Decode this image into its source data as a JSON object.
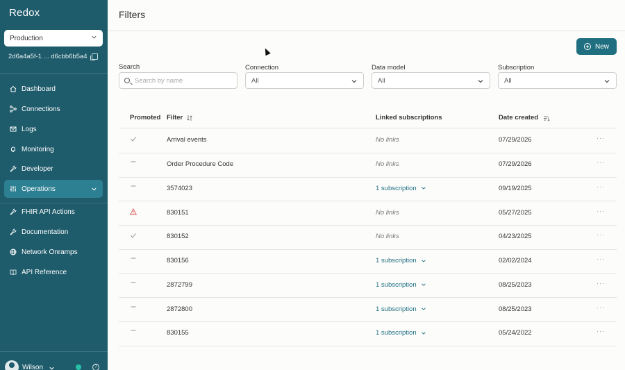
{
  "sidebar": {
    "brand": "Redox",
    "environment": "Production",
    "environment_id": "2d6a4a5f-1 ... d6cbb6b5a4",
    "items": [
      {
        "label": "Dashboard",
        "icon": "home-icon"
      },
      {
        "label": "Connections",
        "icon": "connections-icon"
      },
      {
        "label": "Logs",
        "icon": "envelope-icon"
      },
      {
        "label": "Monitoring",
        "icon": "bell-icon"
      },
      {
        "label": "Developer",
        "icon": "wrench-icon"
      },
      {
        "label": "Operations",
        "icon": "sliders-icon",
        "active": true
      },
      {
        "label": "FHIR API Actions",
        "icon": "wrench-icon"
      },
      {
        "label": "Documentation",
        "icon": "wrench-icon"
      },
      {
        "label": "Network Onramps",
        "icon": "globe-icon"
      },
      {
        "label": "API Reference",
        "icon": "book-icon"
      }
    ],
    "user": {
      "name": "Wilson",
      "help": "?"
    }
  },
  "header": {
    "title": "Filters"
  },
  "toolbar": {
    "new_label": "New"
  },
  "filters": {
    "search_label": "Search",
    "search_placeholder": "Search by name",
    "connection_label": "Connection",
    "connection_value": "All",
    "data_model_label": "Data model",
    "data_model_value": "All",
    "subscription_label": "Subscription",
    "subscription_value": "All"
  },
  "table": {
    "columns": {
      "promoted": "Promoted",
      "filter": "Filter",
      "linked": "Linked subscriptions",
      "date": "Date created"
    },
    "more_label": "···",
    "rows": [
      {
        "promoted": "check",
        "filter": "Arrival events",
        "linked": "No links",
        "date": "07/29/2026"
      },
      {
        "promoted": "dash",
        "filter": "Order Procedure Code",
        "linked": "No links",
        "date": "07/29/2026"
      },
      {
        "promoted": "dash",
        "filter": "3574023",
        "linked": "1 subscription",
        "date": "09/19/2025"
      },
      {
        "promoted": "warning",
        "filter": "830151",
        "linked": "No links",
        "date": "05/27/2025"
      },
      {
        "promoted": "check",
        "filter": "830152",
        "linked": "No links",
        "date": "04/23/2025"
      },
      {
        "promoted": "dash",
        "filter": "830156",
        "linked": "1 subscription",
        "date": "02/02/2024"
      },
      {
        "promoted": "dash",
        "filter": "2872799",
        "linked": "1 subscription",
        "date": "08/25/2023"
      },
      {
        "promoted": "dash",
        "filter": "2872800",
        "linked": "1 subscription",
        "date": "08/25/2023"
      },
      {
        "promoted": "dash",
        "filter": "830155",
        "linked": "1 subscription",
        "date": "05/24/2022"
      }
    ]
  },
  "colors": {
    "sidebar": "#1e5b6b",
    "accent": "#1f6f80",
    "warning": "#d9534f"
  }
}
